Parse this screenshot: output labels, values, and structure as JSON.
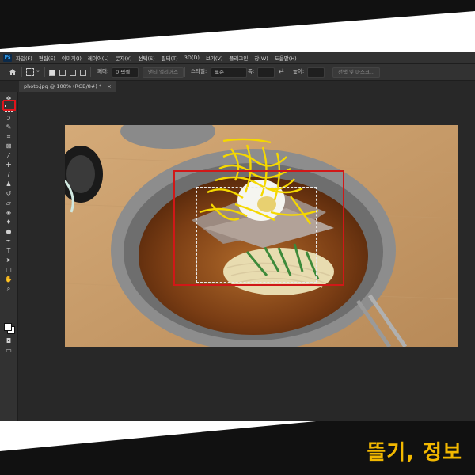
{
  "menu": {
    "logo": "Ps",
    "items": [
      "파일(F)",
      "편집(E)",
      "이미지(I)",
      "레이어(L)",
      "문자(Y)",
      "선택(S)",
      "필터(T)",
      "3D(D)",
      "보기(V)",
      "플러그인",
      "창(W)",
      "도움말(H)"
    ]
  },
  "options": {
    "feather_label": "페더:",
    "feather_value": "0 픽셀",
    "antialias_label": "앤티 앨리어스",
    "style_label": "스타일:",
    "style_value": "표준",
    "width_label": "폭:",
    "height_label": "높이:",
    "select_mask_label": "선택 및 마스크..."
  },
  "document": {
    "tab_title": "photo.jpg @ 100% (RGB/8#) *",
    "close": "×"
  },
  "caption": "뜰기, 정보",
  "colors": {
    "highlight": "#d01818",
    "caption": "#f2b800",
    "ps_background": "#282828"
  }
}
